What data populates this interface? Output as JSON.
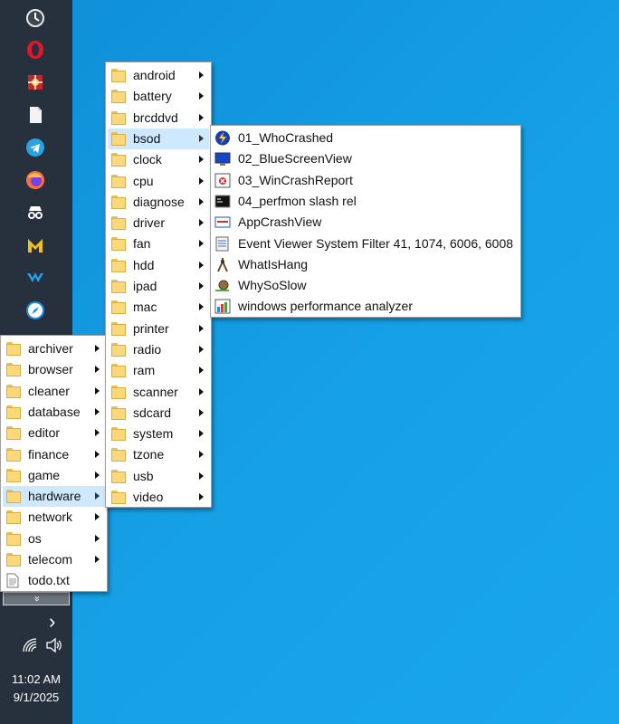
{
  "taskbar": {
    "icons": [
      "clock-app-icon",
      "opera-icon",
      "tool-app-icon",
      "document-icon",
      "telegram-icon",
      "firefox-icon",
      "incognito-icon",
      "malwarebytes-icon",
      "wing-app-icon",
      "safari-compass-icon"
    ],
    "more_glyph": "»",
    "expand_glyph": "›",
    "time": "11:02 AM",
    "date": "9/1/2025"
  },
  "root_menu": {
    "items": [
      {
        "label": "archiver",
        "type": "folder",
        "submenu": true
      },
      {
        "label": "browser",
        "type": "folder",
        "submenu": true
      },
      {
        "label": "cleaner",
        "type": "folder",
        "submenu": true
      },
      {
        "label": "database",
        "type": "folder",
        "submenu": true
      },
      {
        "label": "editor",
        "type": "folder",
        "submenu": true
      },
      {
        "label": "finance",
        "type": "folder",
        "submenu": true
      },
      {
        "label": "game",
        "type": "folder",
        "submenu": true
      },
      {
        "label": "hardware",
        "type": "folder",
        "submenu": true,
        "selected": true
      },
      {
        "label": "network",
        "type": "folder",
        "submenu": true
      },
      {
        "label": "os",
        "type": "folder",
        "submenu": true
      },
      {
        "label": "telecom",
        "type": "folder",
        "submenu": true
      },
      {
        "label": "todo.txt",
        "type": "file",
        "submenu": false
      }
    ]
  },
  "hardware_menu": {
    "items": [
      {
        "label": "android",
        "selected": false
      },
      {
        "label": "battery",
        "selected": false
      },
      {
        "label": "brcddvd",
        "selected": false
      },
      {
        "label": "bsod",
        "selected": true
      },
      {
        "label": "clock",
        "selected": false
      },
      {
        "label": "cpu",
        "selected": false
      },
      {
        "label": "diagnose",
        "selected": false
      },
      {
        "label": "driver",
        "selected": false
      },
      {
        "label": "fan",
        "selected": false
      },
      {
        "label": "hdd",
        "selected": false
      },
      {
        "label": "ipad",
        "selected": false
      },
      {
        "label": "mac",
        "selected": false
      },
      {
        "label": "printer",
        "selected": false
      },
      {
        "label": "radio",
        "selected": false
      },
      {
        "label": "ram",
        "selected": false
      },
      {
        "label": "scanner",
        "selected": false
      },
      {
        "label": "sdcard",
        "selected": false
      },
      {
        "label": "system",
        "selected": false
      },
      {
        "label": "tzone",
        "selected": false
      },
      {
        "label": "usb",
        "selected": false
      },
      {
        "label": "video",
        "selected": false
      }
    ]
  },
  "bsod_menu": {
    "items": [
      {
        "label": "01_WhoCrashed",
        "icon": "lightning-icon"
      },
      {
        "label": "02_BlueScreenView",
        "icon": "blue-screen-icon"
      },
      {
        "label": "03_WinCrashReport",
        "icon": "crash-report-icon"
      },
      {
        "label": "04_perfmon slash rel",
        "icon": "console-icon"
      },
      {
        "label": "AppCrashView",
        "icon": "appcrash-icon"
      },
      {
        "label": "Event Viewer System Filter 41, 1074, 6006, 6008",
        "icon": "event-log-icon"
      },
      {
        "label": "WhatIsHang",
        "icon": "hang-icon"
      },
      {
        "label": "WhySoSlow",
        "icon": "snail-icon"
      },
      {
        "label": "windows performance analyzer",
        "icon": "chart-icon"
      }
    ]
  }
}
